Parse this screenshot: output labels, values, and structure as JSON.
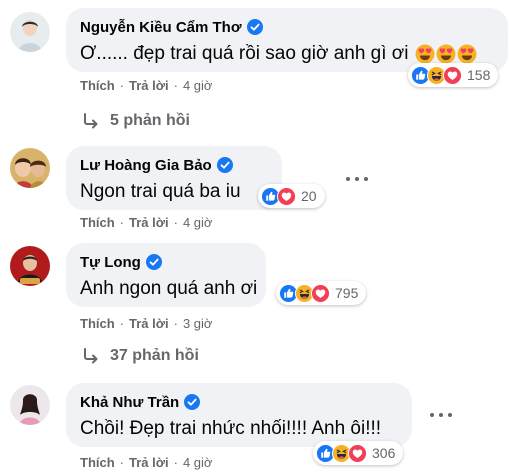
{
  "comments": [
    {
      "name": "Nguyễn Kiều Cẩm Thơ",
      "text": "Ơ...... đẹp trai quá rồi sao giờ anh gì ơi",
      "emojis": [
        "heart-eyes",
        "heart-eyes",
        "heart-eyes"
      ],
      "reactions": [
        "like",
        "haha",
        "love"
      ],
      "reaction_count": "158",
      "like_label": "Thích",
      "reply_label": "Trả lời",
      "time": "4 giờ",
      "replies_label": "5 phản hồi"
    },
    {
      "name": "Lư Hoàng Gia Bảo",
      "text": "Ngon trai quá ba iu",
      "emojis": [],
      "reactions": [
        "like",
        "love"
      ],
      "reaction_count": "20",
      "like_label": "Thích",
      "reply_label": "Trả lời",
      "time": "4 giờ"
    },
    {
      "name": "Tự Long",
      "text": "Anh ngon quá anh ơi",
      "emojis": [],
      "reactions": [
        "like",
        "haha",
        "love"
      ],
      "reaction_count": "795",
      "like_label": "Thích",
      "reply_label": "Trả lời",
      "time": "3 giờ",
      "replies_label": "37 phản hồi"
    },
    {
      "name": "Khả Như Trần",
      "text": "Chồi! Đẹp trai nhức nhối!!!! Anh ôi!!!",
      "emojis": [],
      "reactions": [
        "like",
        "haha",
        "love"
      ],
      "reaction_count": "306",
      "like_label": "Thích",
      "reply_label": "Trả lời",
      "time": "4 giờ"
    }
  ],
  "colors": {
    "bubble_bg": "#f0f2f5",
    "secondary_text": "#65676b",
    "verified_blue": "#1877f2",
    "like_blue": "#1877f2",
    "love_red": "#f33e58",
    "haha_yellow": "#f7b125"
  }
}
